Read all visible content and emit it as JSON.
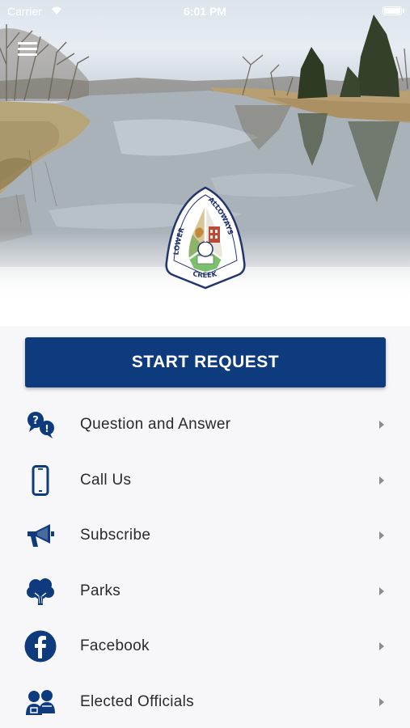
{
  "status_bar": {
    "carrier": "Carrier",
    "time": "6:01 PM"
  },
  "header": {
    "logo_name": "lower-alloways-creek-seal",
    "logo_text_top": "LOWER ALLOWAYS",
    "logo_text_bottom": "CREEK"
  },
  "primary_action": {
    "label": "START REQUEST"
  },
  "colors": {
    "brand_navy": "#0d3b7e",
    "chevron": "#8c8c8c",
    "label_text": "#2a2a2a",
    "background": "#f7f7f9"
  },
  "menu": [
    {
      "label": "Question and Answer",
      "icon": "question-answer-icon"
    },
    {
      "label": "Call Us",
      "icon": "phone-icon"
    },
    {
      "label": "Subscribe",
      "icon": "megaphone-icon"
    },
    {
      "label": "Parks",
      "icon": "tree-icon"
    },
    {
      "label": "Facebook",
      "icon": "facebook-icon"
    },
    {
      "label": "Elected Officials",
      "icon": "officials-icon"
    }
  ]
}
